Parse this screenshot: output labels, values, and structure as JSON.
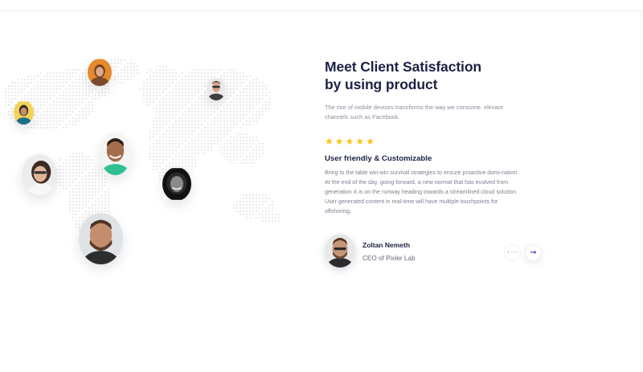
{
  "testimonial": {
    "headline_line1": "Meet Client Satisfaction",
    "headline_line2": "by using product",
    "intro": "The rise of mobile devices transforms the way we consume. elevant channels such as Facebook.",
    "rating": {
      "stars": 5,
      "max": 5,
      "star_color": "#fcc419"
    },
    "feature_title": "User friendly & Customizable",
    "feature_description": "Bring to the table win-win survival strategies to ensure proactive domi-nation. At the end of the day, going forward, a new normal that has evolved from generation X is on the runway heading towards a streamlined cloud solution. User generated content in real-time will have multiple touchpoints for offshoring.",
    "author": {
      "name": "Zoltan Nemeth",
      "role": "CEO of Pixler Lab"
    },
    "nav": {
      "prev_icon": "arrow-left-icon",
      "next_icon": "arrow-right-icon",
      "prev_glyph": "⟵",
      "next_glyph": "➞"
    }
  },
  "colors": {
    "heading": "#1c2145",
    "body_text": "#7d8290",
    "accent": "#3537c8",
    "map_dots": "#e4e4e8"
  }
}
